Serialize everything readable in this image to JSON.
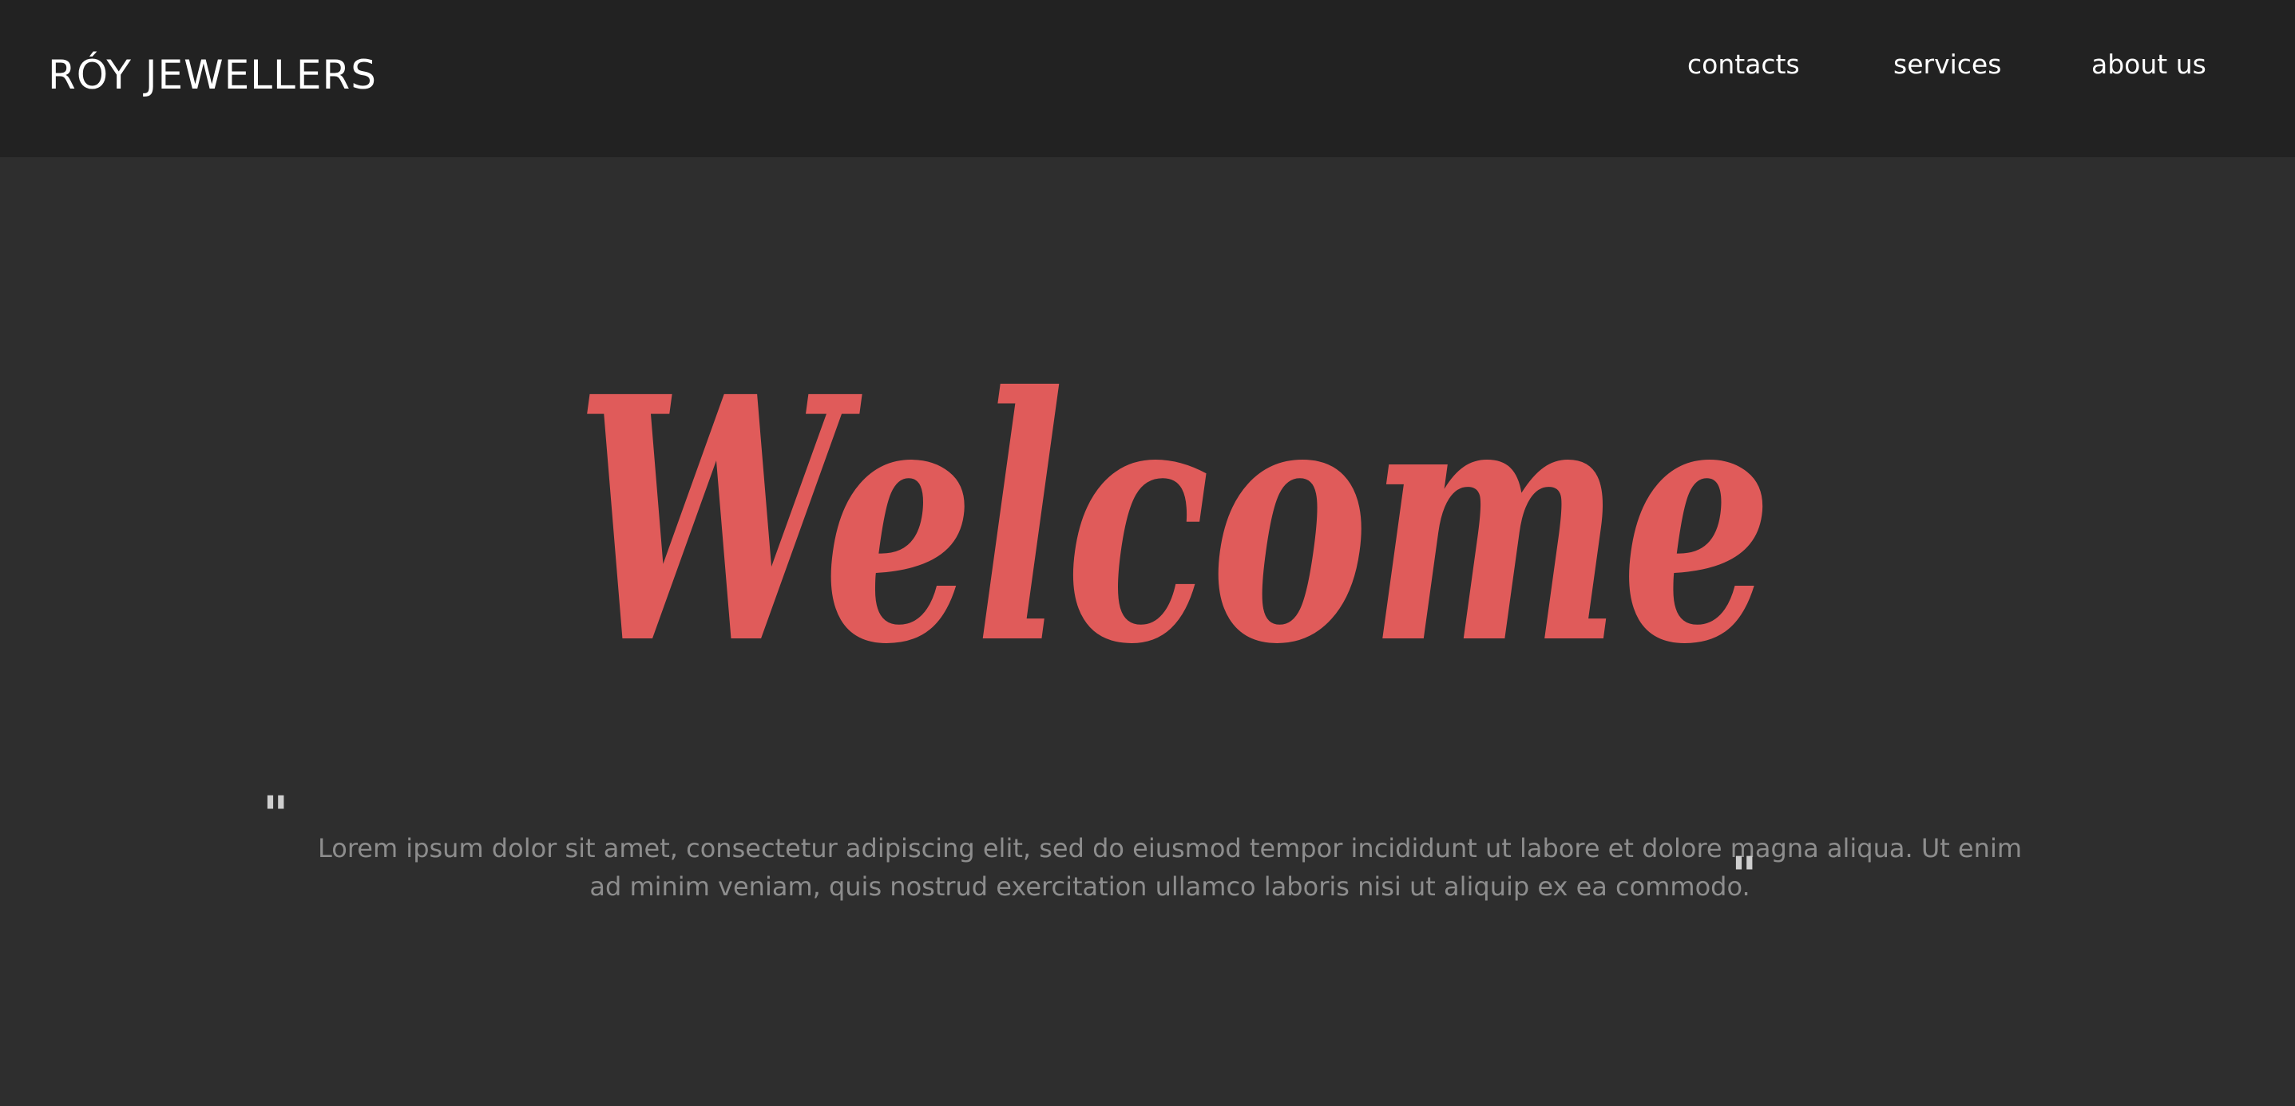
{
  "header": {
    "brand": "RÓY JEWELLERS",
    "nav": [
      {
        "label": "contacts"
      },
      {
        "label": "services"
      },
      {
        "label": "about us"
      }
    ]
  },
  "hero": {
    "heading": "Welcome",
    "quote_open": "\"",
    "quote_close": "\"",
    "text": "Lorem ipsum dolor sit amet, consectetur adipiscing elit, sed do eiusmod tempor incididunt ut labore et dolore magna aliqua. Ut enim ad minim veniam, quis nostrud exercitation ullamco laboris nisi ut aliquip ex ea commodo."
  },
  "colors": {
    "header_bg": "#222222",
    "page_bg": "#2e2e2e",
    "accent": "#e05b5a",
    "body_text": "#8d8d8d",
    "nav_text": "#ffffff"
  }
}
